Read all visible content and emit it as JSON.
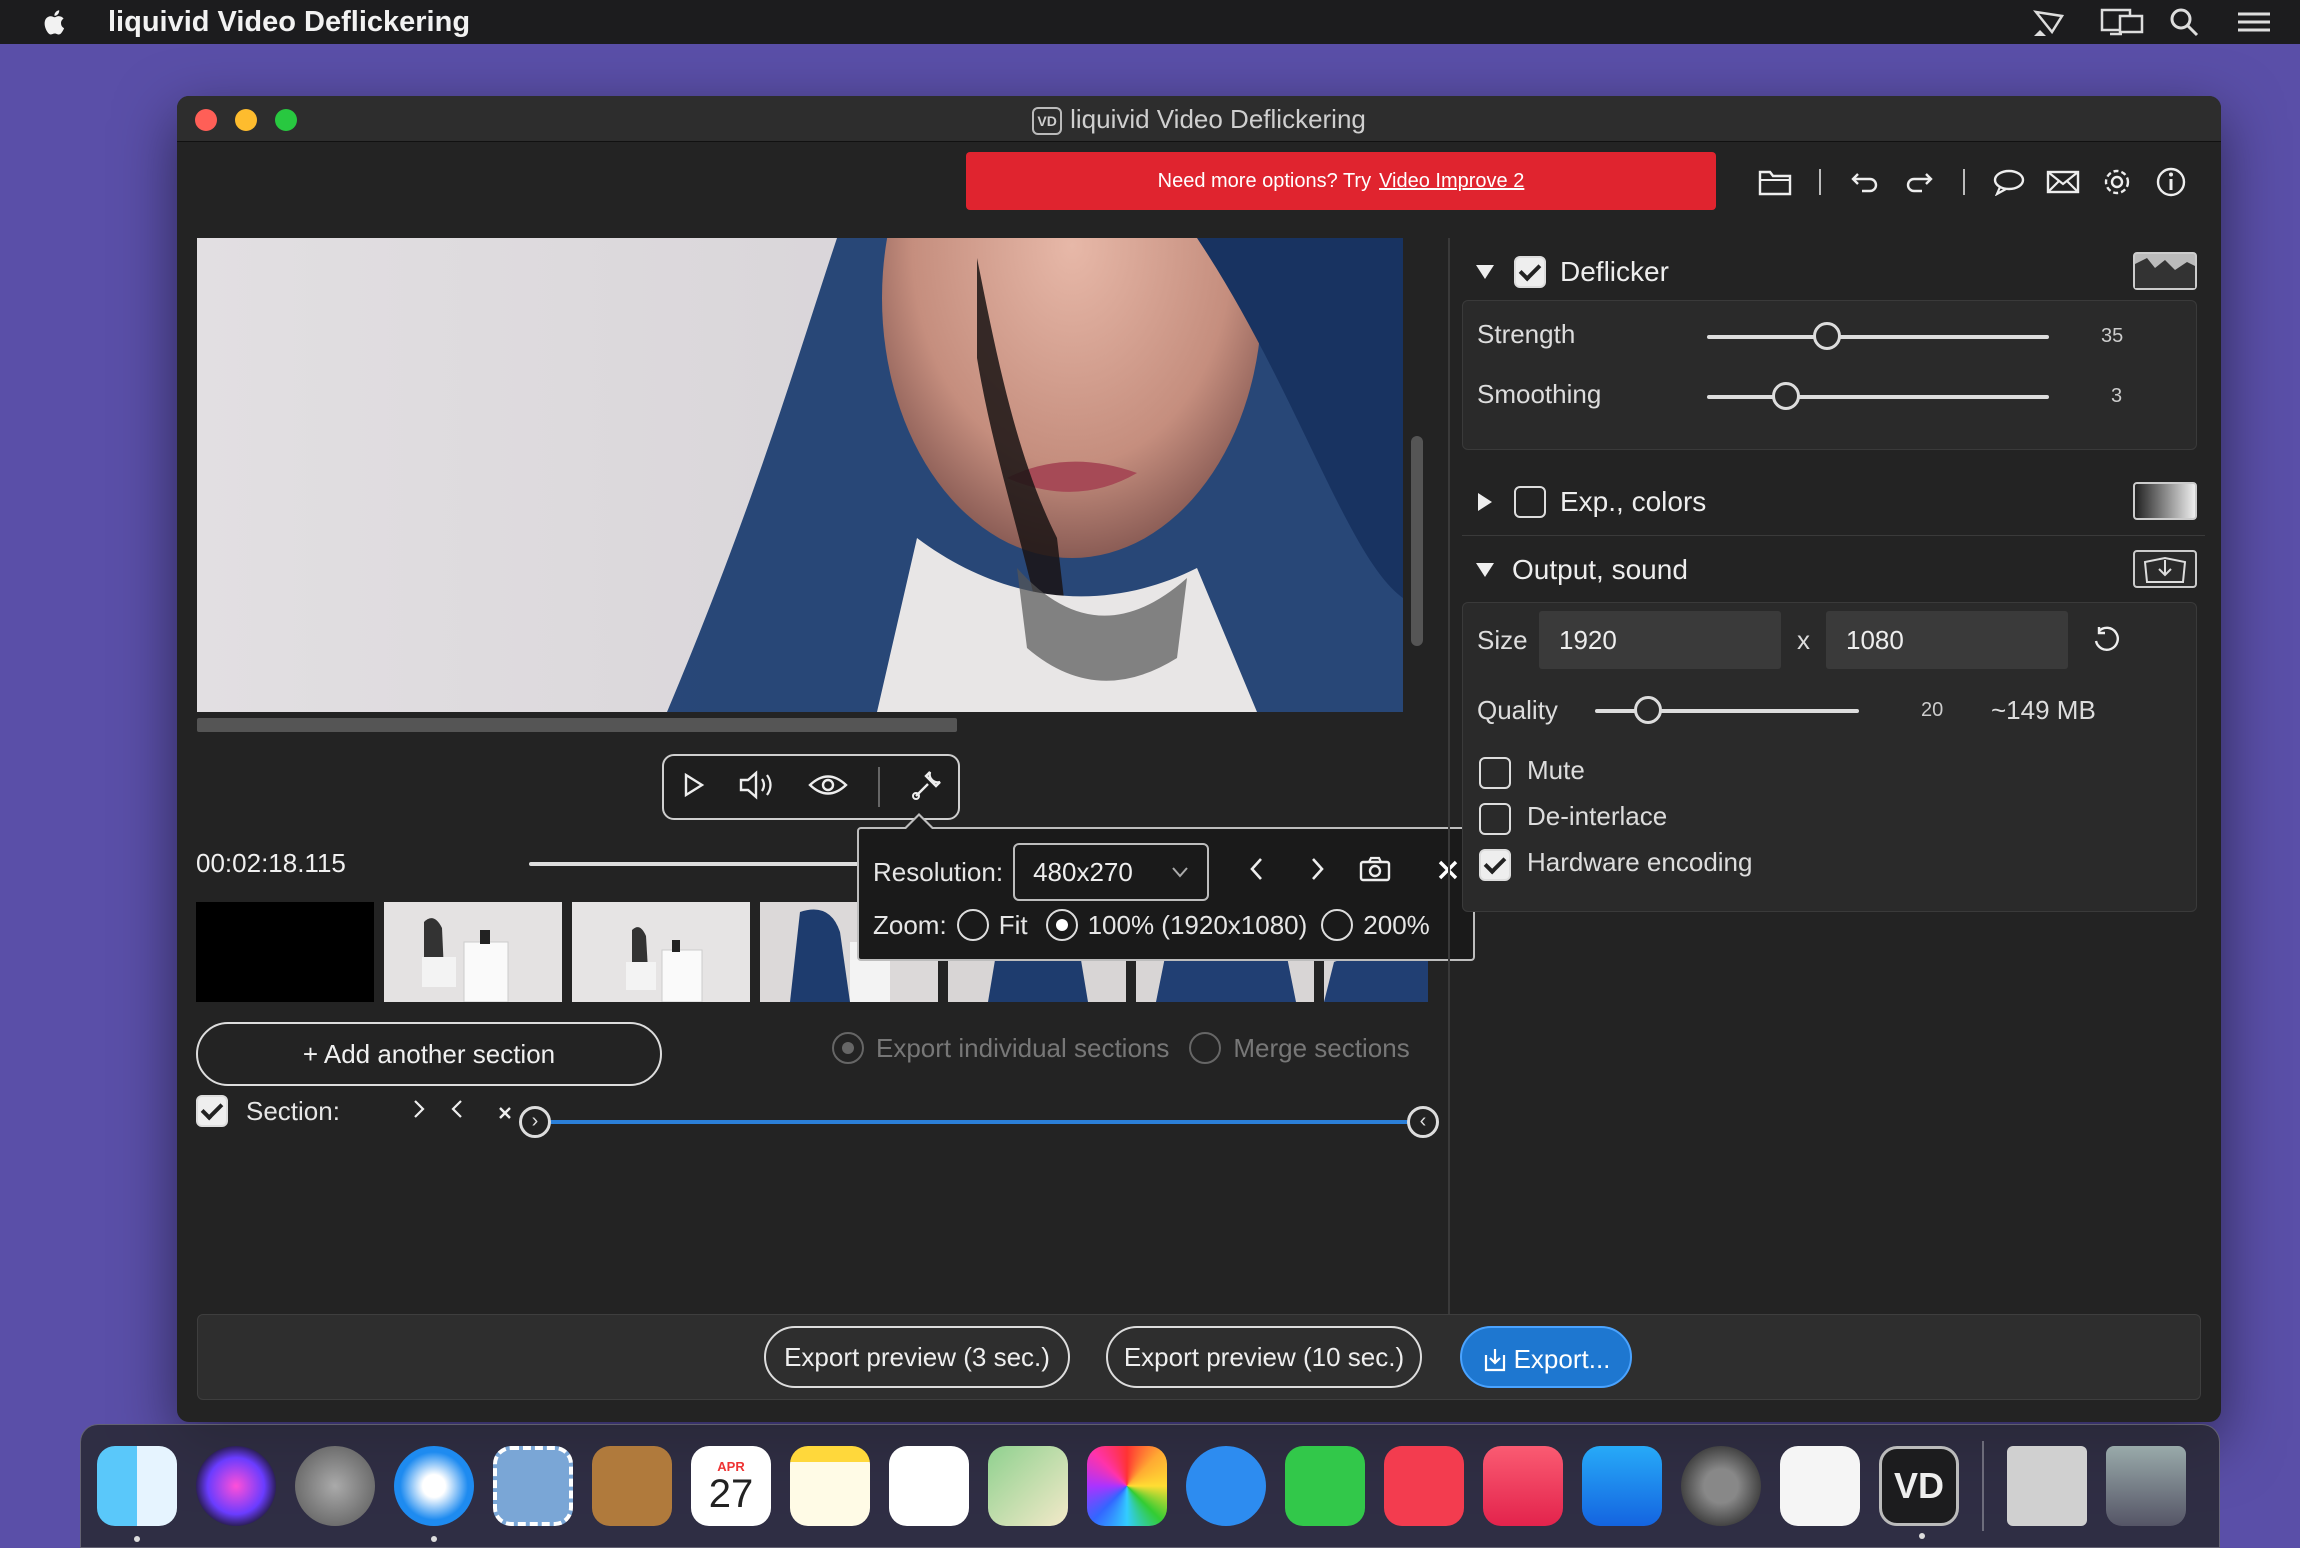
{
  "menubar": {
    "app_name": "liquivid Video Deflickering",
    "icons": [
      "airplay-icon",
      "display-icon",
      "search-icon",
      "control-center-icon"
    ]
  },
  "window": {
    "title": "liquivid Video Deflickering",
    "title_badge": "VD"
  },
  "promo": {
    "text": "Need more options? Try",
    "link": "Video Improve 2",
    "color": "#e0242f"
  },
  "toolbar": {
    "icons": [
      "folder-icon",
      "undo-icon",
      "redo-icon",
      "speech-bubble-icon",
      "mail-icon",
      "gear-icon",
      "info-icon"
    ]
  },
  "player": {
    "timecode": "00:02:18.115",
    "controls": [
      "play-icon",
      "volume-icon",
      "eye-icon",
      "wrench-icon"
    ]
  },
  "popover": {
    "resolution_label": "Resolution:",
    "resolution_value": "480x270",
    "zoom_label": "Zoom:",
    "zoom_options": [
      {
        "label": "Fit",
        "selected": false
      },
      {
        "label": "100% (1920x1080)",
        "selected": true
      },
      {
        "label": "200%",
        "selected": false
      }
    ]
  },
  "sections": {
    "add_label": "+ Add another section",
    "export_individual": "Export individual sections",
    "merge": "Merge sections",
    "section_label": "Section:",
    "section_checked": true
  },
  "panel": {
    "deflicker": {
      "title": "Deflicker",
      "enabled": true,
      "strength_label": "Strength",
      "strength_value": "35",
      "strength_fraction": 0.35,
      "smoothing_label": "Smoothing",
      "smoothing_value": "3",
      "smoothing_fraction": 0.23
    },
    "exp_colors": {
      "title": "Exp., colors",
      "enabled": false
    },
    "output": {
      "title": "Output, sound",
      "size_label": "Size",
      "width": "1920",
      "x_label": "x",
      "height": "1080",
      "quality_label": "Quality",
      "quality_value": "20",
      "quality_fraction": 0.2,
      "file_size": "~149 MB",
      "mute_label": "Mute",
      "mute": false,
      "deinterlace_label": "De-interlace",
      "deinterlace": false,
      "hw_label": "Hardware encoding",
      "hw": true
    }
  },
  "bottom": {
    "preview3": "Export preview (3 sec.)",
    "preview10": "Export preview (10 sec.)",
    "export": "Export...",
    "accent": "#1e77d0"
  },
  "dock": {
    "calendar_month": "APR",
    "calendar_day": "27",
    "vd_label": "VD",
    "items": [
      "finder-icon",
      "siri-icon",
      "launchpad-icon",
      "safari-icon",
      "mail-stamp-icon",
      "contacts-icon",
      "calendar-icon",
      "notes-icon",
      "reminders-icon",
      "maps-icon",
      "photos-icon",
      "messages-icon",
      "facetime-icon",
      "news-icon",
      "music-icon",
      "app-store-icon",
      "system-preferences-icon",
      "textedit-icon",
      "video-deflickering-icon",
      "downloads-icon",
      "trash-icon"
    ]
  }
}
